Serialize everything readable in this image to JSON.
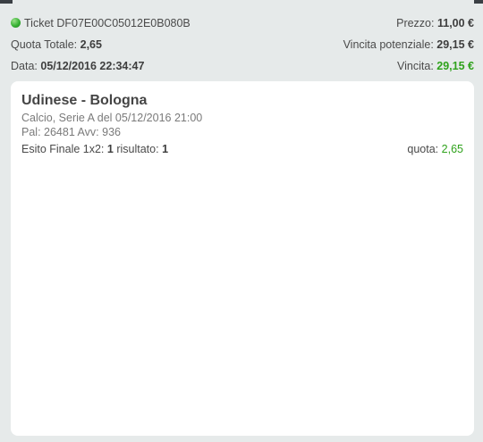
{
  "ticket": {
    "label": "Ticket",
    "id": "DF07E00C05012E0B080B",
    "status_color": "#37b233"
  },
  "summary": {
    "prezzo_label": "Prezzo:",
    "prezzo_value": "11,00 €",
    "quota_totale_label": "Quota Totale:",
    "quota_totale_value": "2,65",
    "vincita_potenziale_label": "Vincita potenziale:",
    "vincita_potenziale_value": "29,15 €",
    "data_label": "Data:",
    "data_value": "05/12/2016 22:34:47",
    "vincita_label": "Vincita:",
    "vincita_value": "29,15 €"
  },
  "event": {
    "match": "Udinese - Bologna",
    "details": "Calcio, Serie A del 05/12/2016 21:00",
    "pal_avv": "Pal: 26481 Avv: 936",
    "market_label": "Esito Finale 1x2:",
    "market_value": "1",
    "result_label": "risultato:",
    "result_value": "1",
    "quota_label": "quota:",
    "quota_value": "2,65"
  },
  "colors": {
    "background": "#e6eaea",
    "card": "#ffffff",
    "win_green": "#2fa21c"
  }
}
